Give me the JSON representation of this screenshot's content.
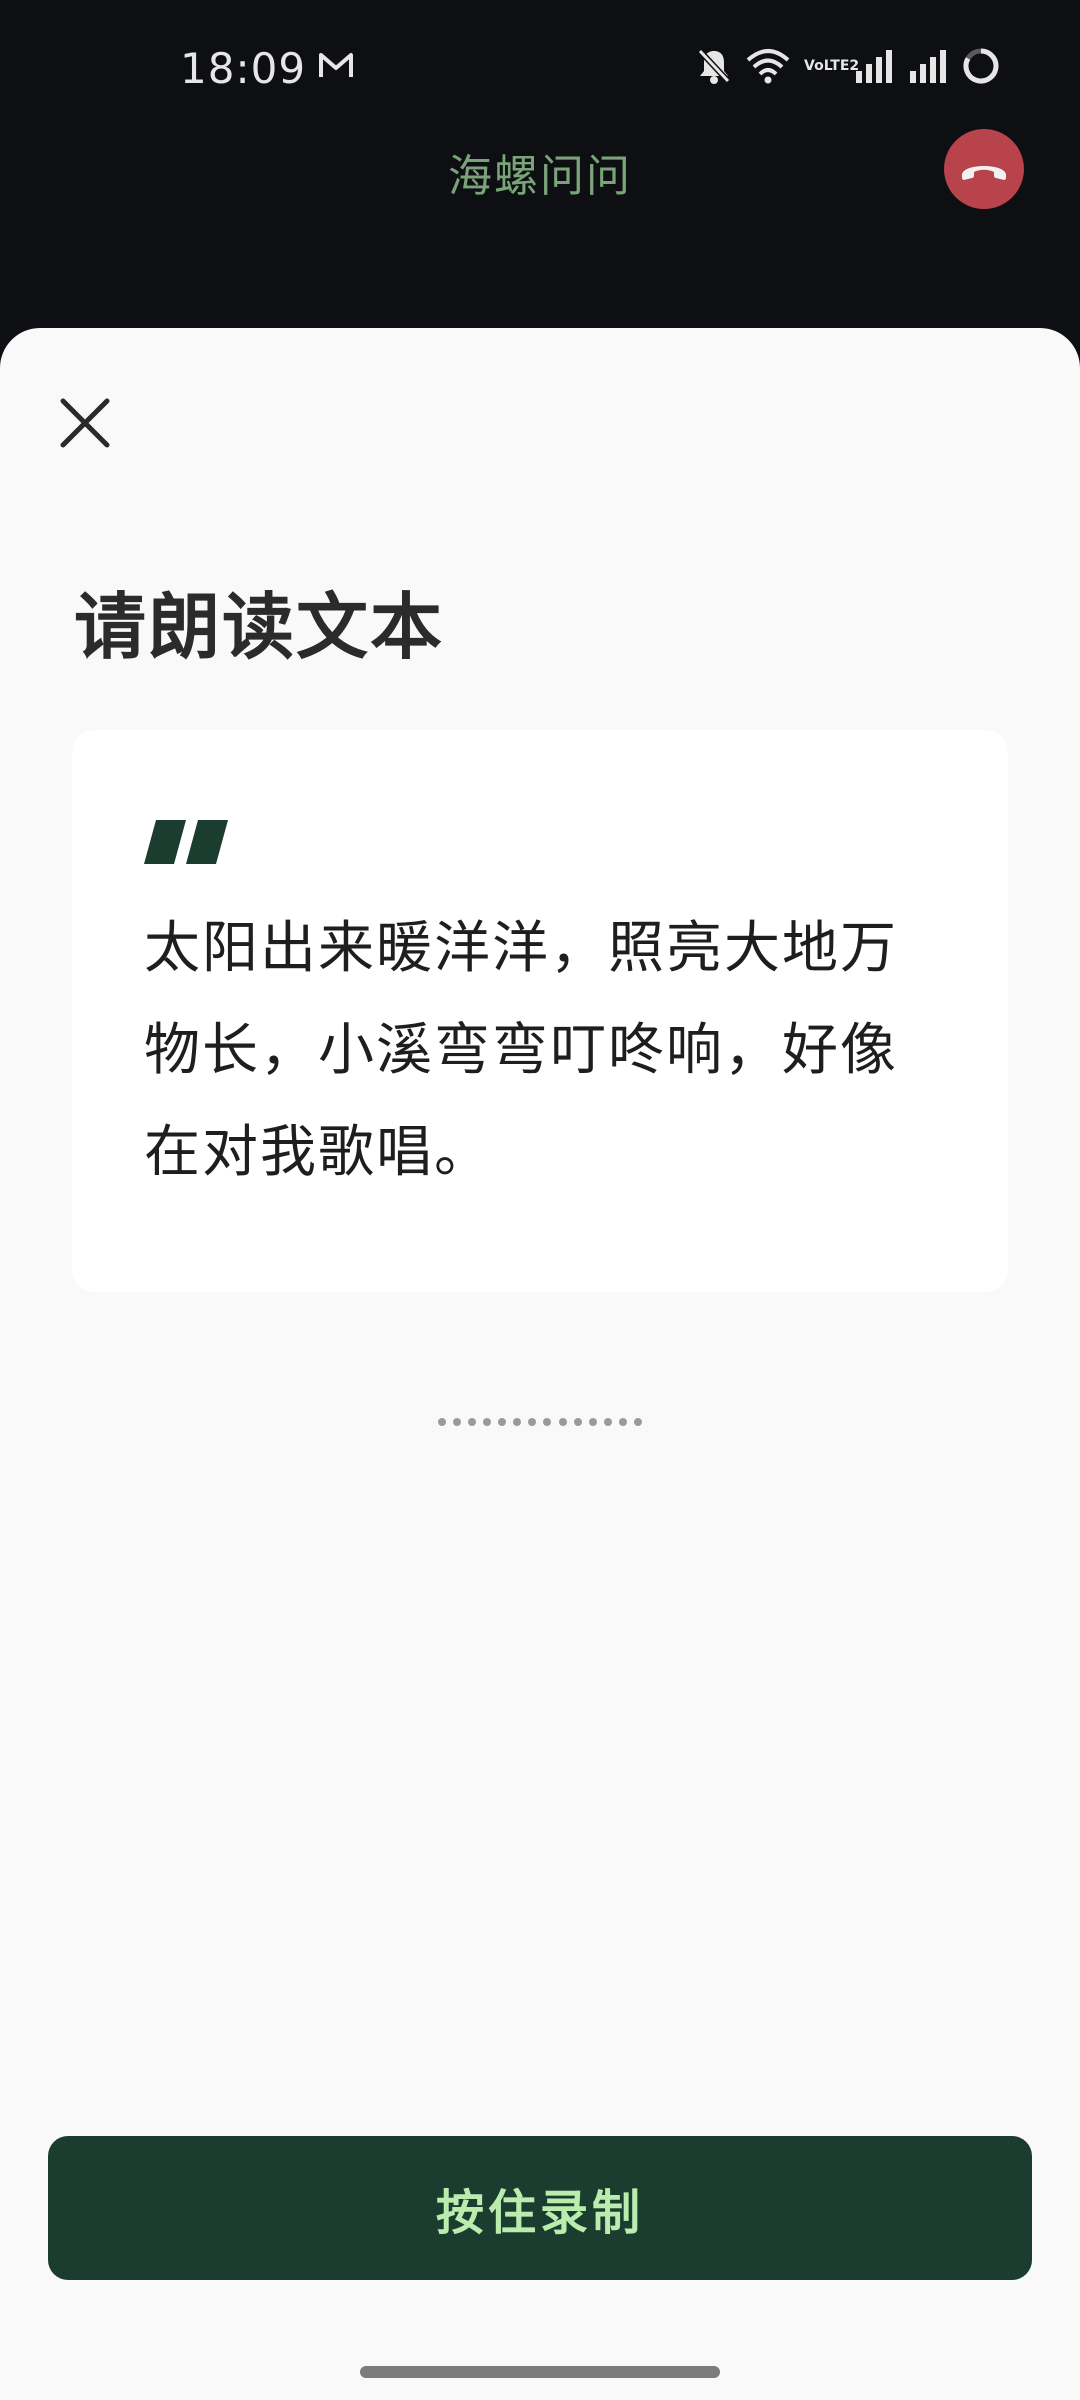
{
  "status_bar": {
    "time": "18:09",
    "network_label": "VoLTE2"
  },
  "header": {
    "title": "海螺问问"
  },
  "sheet": {
    "title": "请朗读文本",
    "passage": "太阳出来暖洋洋，照亮大地万物长，小溪弯弯叮咚响，好像在对我歌唱。",
    "record_button_label": "按住录制"
  },
  "colors": {
    "accent_dark_green": "#1b3d2f",
    "button_text_green": "#b9ecad",
    "header_title_green": "#7aa37a",
    "end_call_red": "#b8434b"
  },
  "icons": [
    "mail-icon",
    "mute-icon",
    "wifi-icon",
    "signal-icon",
    "battery-icon",
    "end-call-icon",
    "close-icon",
    "quote-icon"
  ]
}
